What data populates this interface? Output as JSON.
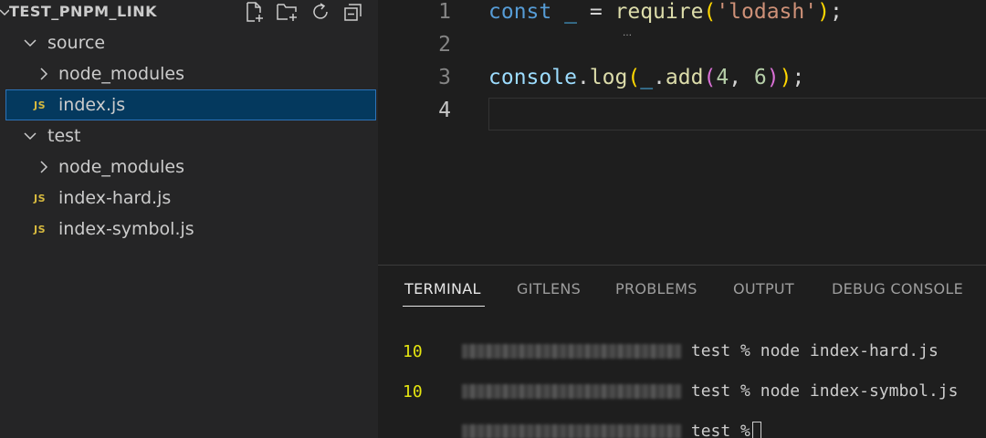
{
  "explorer": {
    "title": "TEST_PNPM_LINK",
    "actions": [
      {
        "name": "new-file-icon"
      },
      {
        "name": "new-folder-icon"
      },
      {
        "name": "refresh-icon"
      },
      {
        "name": "collapse-all-icon"
      }
    ],
    "tree": [
      {
        "label": "source",
        "type": "folder",
        "expanded": true,
        "depth": 1
      },
      {
        "label": "node_modules",
        "type": "folder",
        "expanded": false,
        "depth": 2
      },
      {
        "label": "index.js",
        "type": "file",
        "badge": "JS",
        "depth": 2,
        "selected": true
      },
      {
        "label": "test",
        "type": "folder",
        "expanded": true,
        "depth": 1
      },
      {
        "label": "node_modules",
        "type": "folder",
        "expanded": false,
        "depth": 2
      },
      {
        "label": "index-hard.js",
        "type": "file",
        "badge": "JS",
        "depth": 2
      },
      {
        "label": "index-symbol.js",
        "type": "file",
        "badge": "JS",
        "depth": 2
      }
    ]
  },
  "editor": {
    "line_numbers": [
      "1",
      "2",
      "3",
      "4"
    ],
    "active_line": 4,
    "lines": [
      [
        {
          "t": "const",
          "c": "kw"
        },
        {
          "t": " ",
          "c": "plain"
        },
        {
          "t": "_",
          "c": "var"
        },
        {
          "t": " = ",
          "c": "plain"
        },
        {
          "t": "require",
          "c": "fn"
        },
        {
          "t": "(",
          "c": "p1"
        },
        {
          "t": "'lodash'",
          "c": "str"
        },
        {
          "t": ")",
          "c": "p1"
        },
        {
          "t": ";",
          "c": "plain"
        }
      ],
      [],
      [
        {
          "t": "console",
          "c": "obj"
        },
        {
          "t": ".",
          "c": "plain"
        },
        {
          "t": "log",
          "c": "fn"
        },
        {
          "t": "(",
          "c": "p1"
        },
        {
          "t": "_",
          "c": "var"
        },
        {
          "t": ".",
          "c": "plain"
        },
        {
          "t": "add",
          "c": "fn"
        },
        {
          "t": "(",
          "c": "p2"
        },
        {
          "t": "4",
          "c": "num"
        },
        {
          "t": ", ",
          "c": "plain"
        },
        {
          "t": "6",
          "c": "num"
        },
        {
          "t": ")",
          "c": "p2"
        },
        {
          "t": ")",
          "c": "p1"
        },
        {
          "t": ";",
          "c": "plain"
        }
      ],
      []
    ]
  },
  "panel": {
    "tabs": [
      "TERMINAL",
      "GITLENS",
      "PROBLEMS",
      "OUTPUT",
      "DEBUG CONSOLE"
    ],
    "active_tab": "TERMINAL",
    "terminal": {
      "lines": [
        {
          "prompt": "test %",
          "cmd": " node index-hard.js"
        },
        {
          "output": "10"
        },
        {
          "prompt": "test %",
          "cmd": " node index-symbol.js"
        },
        {
          "output": "10"
        },
        {
          "prompt": "test %",
          "cmd": "",
          "cursor": true
        }
      ]
    }
  },
  "colors": {
    "sidebar_bg": "#252526",
    "editor_bg": "#1e1e1e",
    "selection_bg": "#04395e",
    "selection_border": "#2c73b8",
    "js_badge": "#d7ba3f",
    "terminal_output": "#e5e510"
  }
}
